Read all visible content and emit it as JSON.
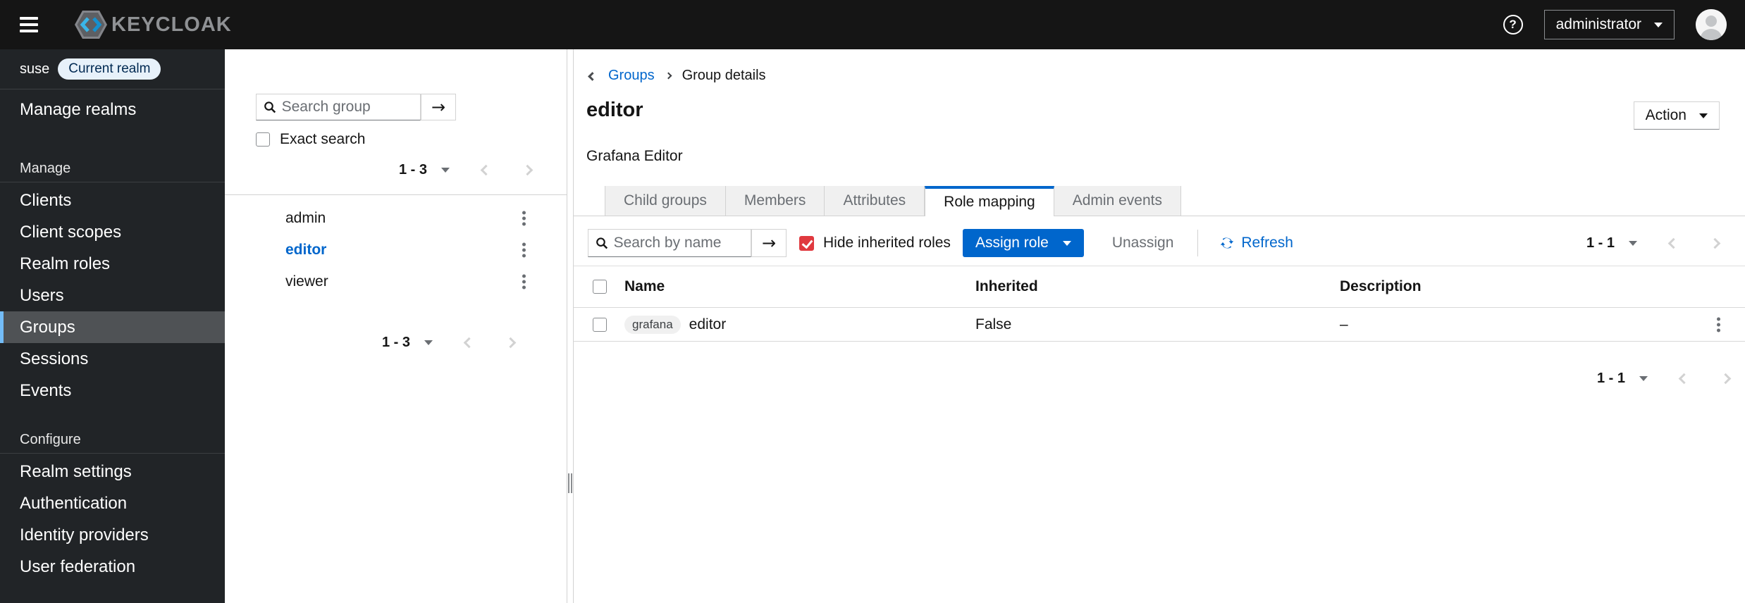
{
  "header": {
    "brand": "KEYCLOAK",
    "help_glyph": "?",
    "user": "administrator"
  },
  "icons": {
    "arrow_glyph": "→"
  },
  "sidebar": {
    "realm_name": "suse",
    "realm_badge": "Current realm",
    "manage_realms": "Manage realms",
    "sections": [
      {
        "label": "Manage",
        "items": [
          {
            "label": "Clients"
          },
          {
            "label": "Client scopes"
          },
          {
            "label": "Realm roles"
          },
          {
            "label": "Users"
          },
          {
            "label": "Groups",
            "current": true
          },
          {
            "label": "Sessions"
          },
          {
            "label": "Events"
          }
        ]
      },
      {
        "label": "Configure",
        "items": [
          {
            "label": "Realm settings"
          },
          {
            "label": "Authentication"
          },
          {
            "label": "Identity providers"
          },
          {
            "label": "User federation"
          }
        ]
      }
    ]
  },
  "groups_panel": {
    "search_placeholder": "Search group",
    "exact_search_label": "Exact search",
    "exact_search_checked": false,
    "top_pagination": "1 - 3",
    "items": [
      {
        "name": "admin",
        "selected": false
      },
      {
        "name": "editor",
        "selected": true
      },
      {
        "name": "viewer",
        "selected": false
      }
    ],
    "bottom_pagination": "1 - 3"
  },
  "main": {
    "breadcrumb": {
      "parent": "Groups",
      "current": "Group details"
    },
    "title": "editor",
    "subtitle": "Grafana Editor",
    "action_label": "Action",
    "tabs": [
      {
        "label": "Child groups"
      },
      {
        "label": "Members"
      },
      {
        "label": "Attributes"
      },
      {
        "label": "Role mapping",
        "active": true
      },
      {
        "label": "Admin events"
      }
    ],
    "toolbar": {
      "search_placeholder": "Search by name",
      "hide_inherited_label": "Hide inherited roles",
      "hide_inherited_checked": true,
      "assign_role_label": "Assign role",
      "unassign_label": "Unassign",
      "refresh_label": "Refresh",
      "pagination": "1 - 1"
    },
    "table": {
      "columns": {
        "name": "Name",
        "inherited": "Inherited",
        "description": "Description"
      },
      "rows": [
        {
          "client_badge": "grafana",
          "name": "editor",
          "inherited": "False",
          "description": "–"
        }
      ],
      "pagination": "1 - 1"
    }
  },
  "colors": {
    "masthead_bg": "#151515",
    "sidebar_bg": "#212427",
    "accent_blue": "#0066cc",
    "active_tab_border": "#0066cc",
    "checkbox_checked_red": "#e0393f",
    "nav_current_indicator": "#73bcf7",
    "nav_current_bg": "#4f5255",
    "realm_badge_bg": "#e7f1fa",
    "realm_badge_text": "#002952",
    "border_gray": "#d2d2d2",
    "muted_text": "#6a6e73"
  }
}
